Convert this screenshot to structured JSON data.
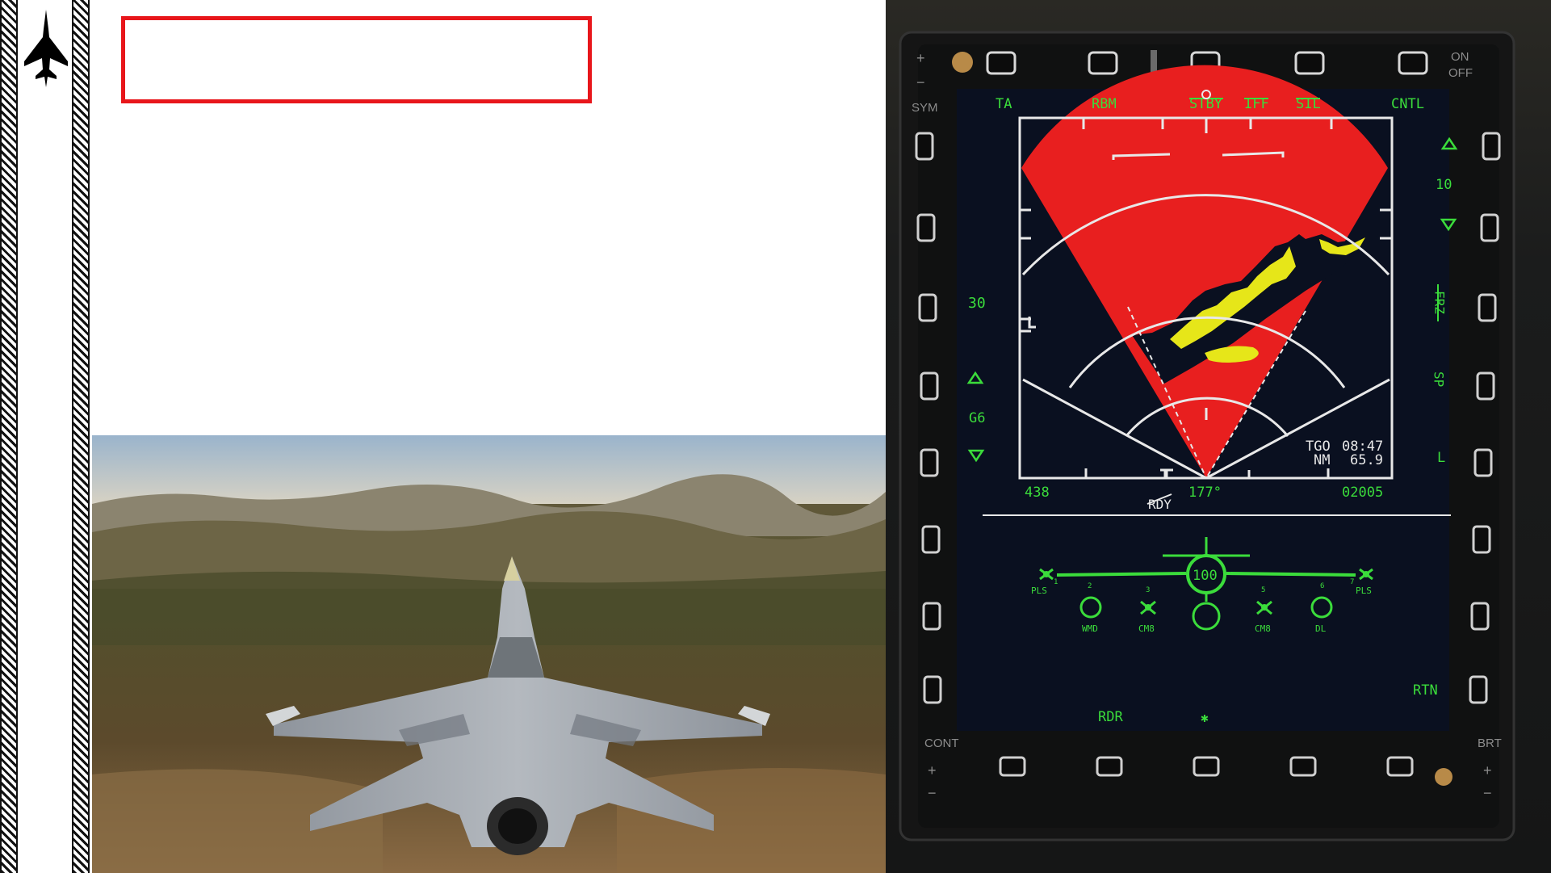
{
  "title_box": {
    "text": ""
  },
  "mfd": {
    "bezel": {
      "sym": "SYM",
      "on": "ON",
      "off": "OFF",
      "cont": "CONT",
      "brt": "BRT",
      "plus": "+",
      "minus": "−"
    },
    "top_labels": [
      "TA",
      "RBM",
      "STBY",
      "IFF",
      "SIL",
      "CNTL"
    ],
    "left_labels": {
      "range": "30",
      "gain": "G6"
    },
    "right_labels": {
      "scale": "10",
      "frz": "FRZ",
      "sp": "SP",
      "l": "L",
      "rtn": "RTN"
    },
    "radar": {
      "bottom_left": "438",
      "heading": "177°",
      "bottom_right": "02005",
      "rdy": "RDY",
      "tgo_label": "TGO",
      "tgo_value": "08:47",
      "nm_label": "NM",
      "nm_value": "65.9"
    },
    "stores": {
      "center_value": "100",
      "stations": [
        "1",
        "2",
        "3",
        "5",
        "6",
        "7"
      ],
      "labels": [
        "PLS",
        "WMD",
        "CM8",
        "CM8",
        "DL",
        "PLS"
      ]
    },
    "bottom_labels": {
      "rdr": "RDR",
      "star": "✱"
    },
    "colors": {
      "symbology": "#3bdc3b",
      "radar_sector": "#e81f1f",
      "terrain": "#e6e619",
      "lines": "#e8e8e8"
    }
  }
}
